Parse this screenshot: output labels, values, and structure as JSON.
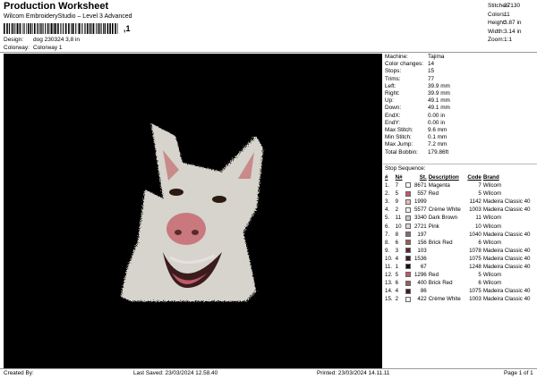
{
  "header": {
    "title": "Production Worksheet",
    "subtitle": "Wilcom EmbroideryStudio – Level 3 Advanced",
    "barcode_mark": ",1",
    "design_label": "Design:",
    "design_value": "dog 230324 3,8 in",
    "colorway_label": "Colorway:",
    "colorway_value": "Colorway 1"
  },
  "stats": [
    {
      "label": "Stitches:",
      "value": "27130"
    },
    {
      "label": "Colors:",
      "value": "11"
    },
    {
      "label": "Height:",
      "value": "3.87 in"
    },
    {
      "label": "Width:",
      "value": "3.14 in"
    },
    {
      "label": "Zoom:",
      "value": "1:1"
    }
  ],
  "info": [
    {
      "label": "Machine:",
      "value": "Tajima"
    },
    {
      "label": "Color changes:",
      "value": "14"
    },
    {
      "label": "Stops:",
      "value": "15"
    },
    {
      "label": "Trims:",
      "value": "77"
    },
    {
      "label": "Left:",
      "value": "39.9 mm"
    },
    {
      "label": "Right:",
      "value": "39.9 mm"
    },
    {
      "label": "Up:",
      "value": "49.1 mm"
    },
    {
      "label": "Down:",
      "value": "49.1 mm"
    },
    {
      "label": "EndX:",
      "value": "0.00 in"
    },
    {
      "label": "EndY:",
      "value": "0.00 in"
    },
    {
      "label": "Max Stitch:",
      "value": "9.6 mm"
    },
    {
      "label": "Min Stitch:",
      "value": "0.1 mm"
    },
    {
      "label": "Max Jump:",
      "value": "7.2 mm"
    },
    {
      "label": "Total Bobbin:",
      "value": "179.86ft"
    }
  ],
  "stop_sequence": {
    "title": "Stop Sequence:",
    "headers": [
      "#",
      "N#",
      "",
      "St.",
      "Description",
      "Code",
      "Brand"
    ],
    "rows": [
      {
        "n": "1.",
        "nn": "7",
        "color": "#ffffff",
        "st": "8671",
        "desc": "Magenta",
        "code": "7",
        "brand": "Wilcom"
      },
      {
        "n": "2.",
        "nn": "5",
        "color": "#c05a6a",
        "st": "557",
        "desc": "Red",
        "code": "5",
        "brand": "Wilcom"
      },
      {
        "n": "3.",
        "nn": "9",
        "color": "#e6bcbc",
        "st": "1999",
        "desc": "",
        "code": "1142",
        "brand": "Madeira Classic 40"
      },
      {
        "n": "4.",
        "nn": "2",
        "color": "#f4f2ee",
        "st": "5577",
        "desc": "Crème White",
        "code": "1003",
        "brand": "Madeira Classic 40"
      },
      {
        "n": "5.",
        "nn": "11",
        "color": "#c8c8c8",
        "st": "3340",
        "desc": "Dark Brown",
        "code": "11",
        "brand": "Wilcom"
      },
      {
        "n": "6.",
        "nn": "10",
        "color": "#d8d8d8",
        "st": "2721",
        "desc": "Pink",
        "code": "10",
        "brand": "Wilcom"
      },
      {
        "n": "7.",
        "nn": "8",
        "color": "#8a6a6a",
        "st": "197",
        "desc": "",
        "code": "1040",
        "brand": "Madeira Classic 40"
      },
      {
        "n": "8.",
        "nn": "6",
        "color": "#a05a5a",
        "st": "156",
        "desc": "Brick Red",
        "code": "6",
        "brand": "Wilcom"
      },
      {
        "n": "9.",
        "nn": "3",
        "color": "#5a2a2a",
        "st": "103",
        "desc": "",
        "code": "1078",
        "brand": "Madeira Classic 40"
      },
      {
        "n": "10.",
        "nn": "4",
        "color": "#3a2020",
        "st": "1536",
        "desc": "",
        "code": "1075",
        "brand": "Madeira Classic 40"
      },
      {
        "n": "11.",
        "nn": "1",
        "color": "#111111",
        "st": "67",
        "desc": "",
        "code": "1248",
        "brand": "Madeira Classic 40"
      },
      {
        "n": "12.",
        "nn": "5",
        "color": "#c05a6a",
        "st": "1296",
        "desc": "Red",
        "code": "5",
        "brand": "Wilcom"
      },
      {
        "n": "13.",
        "nn": "6",
        "color": "#a05a5a",
        "st": "400",
        "desc": "Brick Red",
        "code": "6",
        "brand": "Wilcom"
      },
      {
        "n": "14.",
        "nn": "4",
        "color": "#3a2020",
        "st": "86",
        "desc": "",
        "code": "1075",
        "brand": "Madeira Classic 40"
      },
      {
        "n": "15.",
        "nn": "2",
        "color": "#f4f2ee",
        "st": "422",
        "desc": "Crème White",
        "code": "1003",
        "brand": "Madeira Classic 40"
      }
    ]
  },
  "footer": {
    "created_by": "Created By:",
    "last_saved": "Last Saved: 23/03/2024 12.58.40",
    "printed": "Printed: 23/03/2024 14.11.11",
    "page": "Page 1 of 1"
  }
}
